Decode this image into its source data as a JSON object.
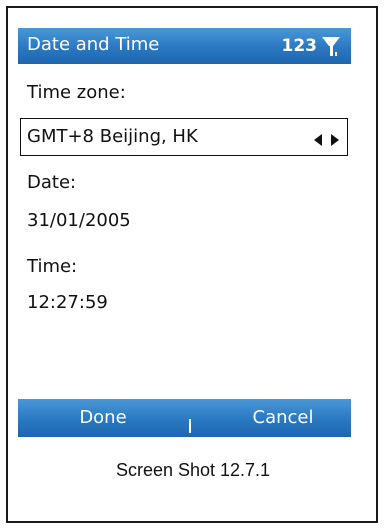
{
  "titlebar": {
    "title": "Date and Time",
    "input_mode": "123",
    "signal_icon": "antenna-signal-icon"
  },
  "form": {
    "time_zone_label": "Time zone:",
    "time_zone_value": "GMT+8 Beijing, HK",
    "date_label": "Date:",
    "date_value": "31/01/2005",
    "time_label": "Time:",
    "time_value": "12:27:59"
  },
  "softkeys": {
    "left": "Done",
    "right": "Cancel"
  },
  "caption": "Screen Shot 12.7.1",
  "colors": {
    "bar_top": "#4a97d7",
    "bar_bottom": "#1d66ae",
    "text": "#111111"
  }
}
